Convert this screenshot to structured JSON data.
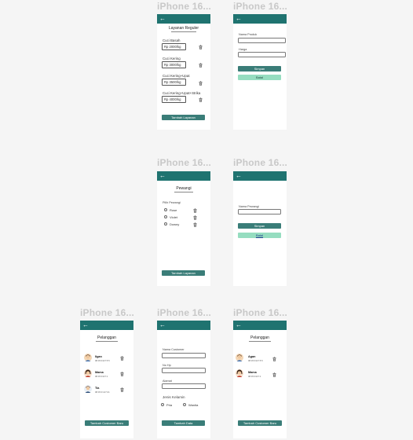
{
  "frame_title": "iPhone 16...",
  "colors": {
    "appbar": "#1f7370",
    "primary_button": "#3a7d78",
    "secondary_button": "#96ddc0",
    "canvas": "#f5f5f5"
  },
  "icons": {
    "back": "arrow-left-icon",
    "delete": "trash-icon",
    "avatar": "person-avatar-icon"
  },
  "services_screen": {
    "title": "Layanan Reguler",
    "items": [
      {
        "label": "Cuci Basah",
        "price": "Rp 2000/kg"
      },
      {
        "label": "Cuci Kering",
        "price": "Rp 3000/kg"
      },
      {
        "label": "Cuci Kering+Upat",
        "price": "Rp 3500/kg"
      },
      {
        "label": "Cuci Kering+Upat+Strika",
        "price": "Rp 4000/kg"
      }
    ],
    "add_button": "Tambah Layanan"
  },
  "add_product_screen": {
    "name_label": "Nama Produk",
    "price_label": "Harga",
    "save_button": "Simpan",
    "cancel_button": "Batal"
  },
  "fragrance_screen": {
    "title": "Pewangi",
    "subtitle": "Pilih Pewangi",
    "options": [
      "Rose",
      "Violet",
      "Downy"
    ],
    "add_button": "Tambah Layanan"
  },
  "add_fragrance_screen": {
    "name_label": "Nama Pewangi",
    "save_button": "Simpan",
    "cancel_button": "Batal"
  },
  "customers_screen": {
    "title": "Pelanggan",
    "customers": [
      {
        "name": "Ilgan",
        "phone": "08:45:0147:5:5"
      },
      {
        "name": "Mama",
        "phone": "08:45:0147:1"
      },
      {
        "name": "Tia",
        "phone": "08:45:0:147:21"
      }
    ],
    "add_button": "Tambah Customer Baru"
  },
  "add_customer_screen": {
    "name_label": "Nama Customer",
    "phone_label": "No Hp",
    "address_label": "Alamat",
    "gender_label": "Jenis Kelamin",
    "gender_options": [
      "Pria",
      "Wanita"
    ],
    "save_button": "Tambah Data"
  },
  "customers_screen_2": {
    "title": "Pelanggan",
    "customers": [
      {
        "name": "Agan",
        "phone": "08:45:0147:5:5"
      },
      {
        "name": "Mama",
        "phone": "08:45:0147:1"
      }
    ],
    "add_button": "Tambah Customer Baru"
  }
}
